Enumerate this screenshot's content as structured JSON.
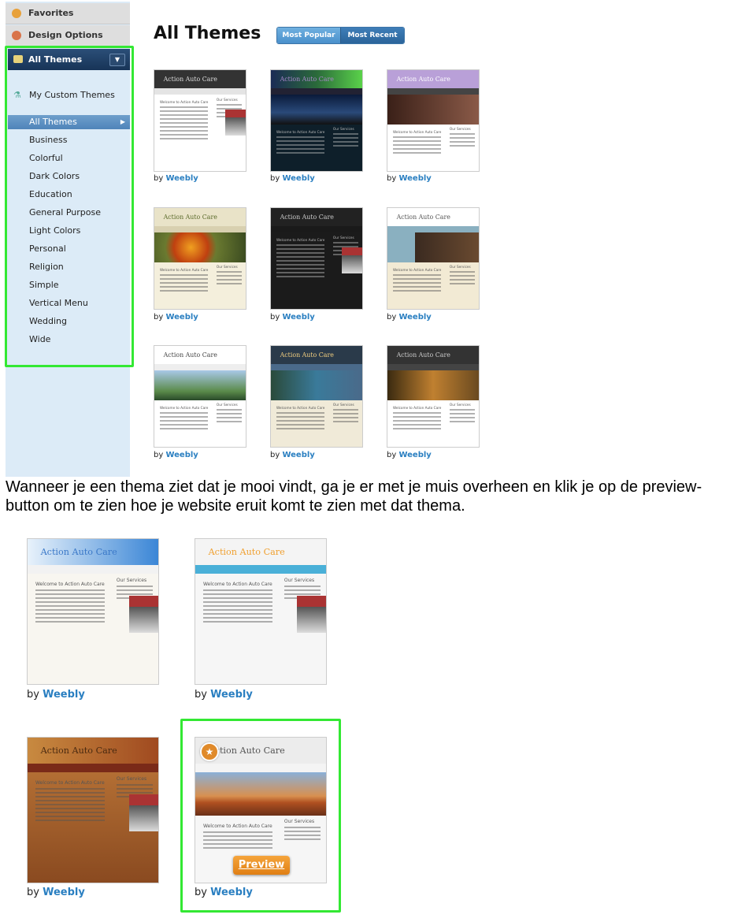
{
  "sidebar": {
    "top_items": [
      {
        "label": "Favorites",
        "icon": "star-icon",
        "color": "#e8a13a"
      },
      {
        "label": "Design Options",
        "icon": "palette-icon",
        "color": "#d9744a"
      }
    ],
    "header": {
      "label": "All Themes",
      "icon": "themes-icon"
    },
    "custom": {
      "label": "My Custom Themes",
      "icon": "flask-icon"
    },
    "categories": [
      "All Themes",
      "Business",
      "Colorful",
      "Dark Colors",
      "Education",
      "General Purpose",
      "Light Colors",
      "Personal",
      "Religion",
      "Simple",
      "Vertical Menu",
      "Wedding",
      "Wide"
    ],
    "selected": "All Themes"
  },
  "main": {
    "title": "All Themes",
    "tabs": [
      {
        "label": "Most Popular",
        "active": true
      },
      {
        "label": "Most Recent",
        "active": false
      }
    ],
    "by_label": "by",
    "author": "Weebly"
  },
  "theme_text": {
    "site": "Action Auto Care",
    "welcome": "Welcome to Action Auto Care",
    "services": "Our Services"
  },
  "themes": [
    {
      "head": "#333",
      "headText": "#ddd",
      "nav": "#e4e4e4",
      "banner": "",
      "bg": "#fff"
    },
    {
      "head": "linear-gradient(90deg,#1b2b55,#2a6a3a,#5ad24a)",
      "headText": "#a8c",
      "nav": "#223",
      "banner": "linear-gradient(#0a1a3a,#2a4a7a 60%,#111)",
      "bg": "#0e1f2a"
    },
    {
      "head": "#b9a0d8",
      "headText": "#fff",
      "nav": "#444",
      "banner": "linear-gradient(90deg,#3a2018,#8a5a48)",
      "bg": "#fff",
      "split": true
    },
    {
      "head": "#e9e3c8",
      "headText": "#5a6a2a",
      "nav": "#d8d0b0",
      "banner": "radial-gradient(circle at 40% 50%,#f0a020,#c04010 30%,#6a7a30 45%,#3a4a20)",
      "bg": "#f4efdc"
    },
    {
      "head": "#222",
      "headText": "#ccc",
      "nav": "#1a1a1a",
      "banner": "",
      "bg": "#1b1b1b"
    },
    {
      "head": "#fff",
      "headText": "#555",
      "nav": "#8ab0c0",
      "banner": "linear-gradient(90deg,#8ab0c0 30%,#3a2a20 30%,#6a4a30)",
      "bg": "#f2ead4"
    },
    {
      "head": "#fff",
      "headText": "#444",
      "nav": "#eee",
      "banner": "linear-gradient(#a8c8e8,#5a8a4a 70%,#2a4a2a)",
      "bg": "#fff"
    },
    {
      "head": "#2a3a4a",
      "headText": "#f4d080",
      "nav": "#4a6a8a",
      "banner": "linear-gradient(90deg,#2a4a3a,#3a7a9a 50%,#4a6a8a)",
      "bg": "#f0ead8"
    },
    {
      "head": "#333",
      "headText": "#ccc",
      "nav": "#444",
      "banner": "linear-gradient(90deg,#3a2a10,#c08030,#6a4a20)",
      "bg": "#fff"
    }
  ],
  "caption": "Wanneer je een thema ziet dat je mooi vindt, ga je er met je muis overheen en klik je op de preview-\nbutton om te zien hoe je website eruit komt te zien met dat thema.",
  "themes2": [
    {
      "head": "linear-gradient(90deg,#e8f2fb,#3b86d6)",
      "headText": "#3a78c8",
      "nav": "#f2f2f2",
      "banner": "",
      "bg": "#f8f6f0"
    },
    {
      "head": "#f4f4f4",
      "headText": "#f0a030",
      "nav": "#4ab0d8",
      "banner": "",
      "bg": "#f6f6f6"
    },
    {
      "head": "linear-gradient(90deg,#c88a40,#a04a20)",
      "headText": "#4a2a10",
      "nav": "#7a2a18",
      "banner": "",
      "bg": "linear-gradient(#c07a3a,#8a4a20)"
    },
    {
      "head": "#ececec",
      "headText": "#555",
      "nav": "#f4f4f4",
      "banner": "linear-gradient(#8ab0d8,#d89050 55%,#b05020 70%,#6a3018)",
      "bg": "#f6f6f6"
    }
  ],
  "preview_label": "Preview"
}
